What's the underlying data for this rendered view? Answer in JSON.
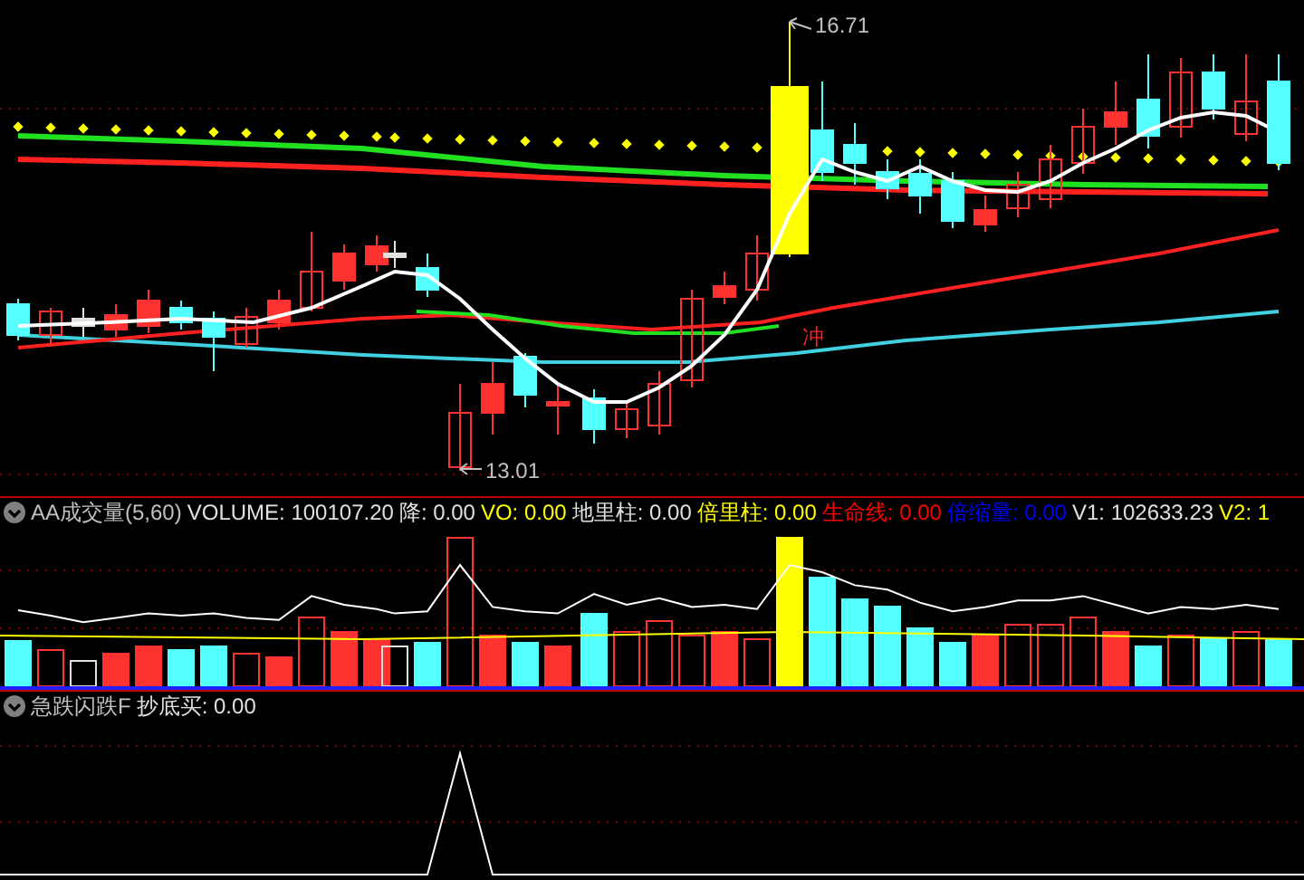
{
  "main_chart": {
    "high_label": "16.71",
    "low_label": "13.01",
    "signal_label": "冲"
  },
  "volume_panel": {
    "indicator": "AA成交量(5,60)",
    "readings": [
      {
        "text": "VOLUME: 100107.20",
        "color": "#e0e0e0"
      },
      {
        "text": "降: 0.00",
        "color": "#e0e0e0"
      },
      {
        "text": "VO: 0.00",
        "color": "#ffff00"
      },
      {
        "text": "地里柱: 0.00",
        "color": "#e0e0e0"
      },
      {
        "text": "倍里柱: 0.00",
        "color": "#ffff00"
      },
      {
        "text": "生命线: 0.00",
        "color": "#ff0000"
      },
      {
        "text": "倍缩量: 0.00",
        "color": "#0000ff"
      },
      {
        "text": "V1: 102633.23",
        "color": "#e0e0e0"
      },
      {
        "text": "V2: 1",
        "color": "#ffff00"
      }
    ]
  },
  "signal_panel": {
    "indicator": "急跌闪跌F",
    "readings": [
      {
        "text": "抄底买: 0.00",
        "color": "#e0e0e0"
      }
    ]
  }
}
